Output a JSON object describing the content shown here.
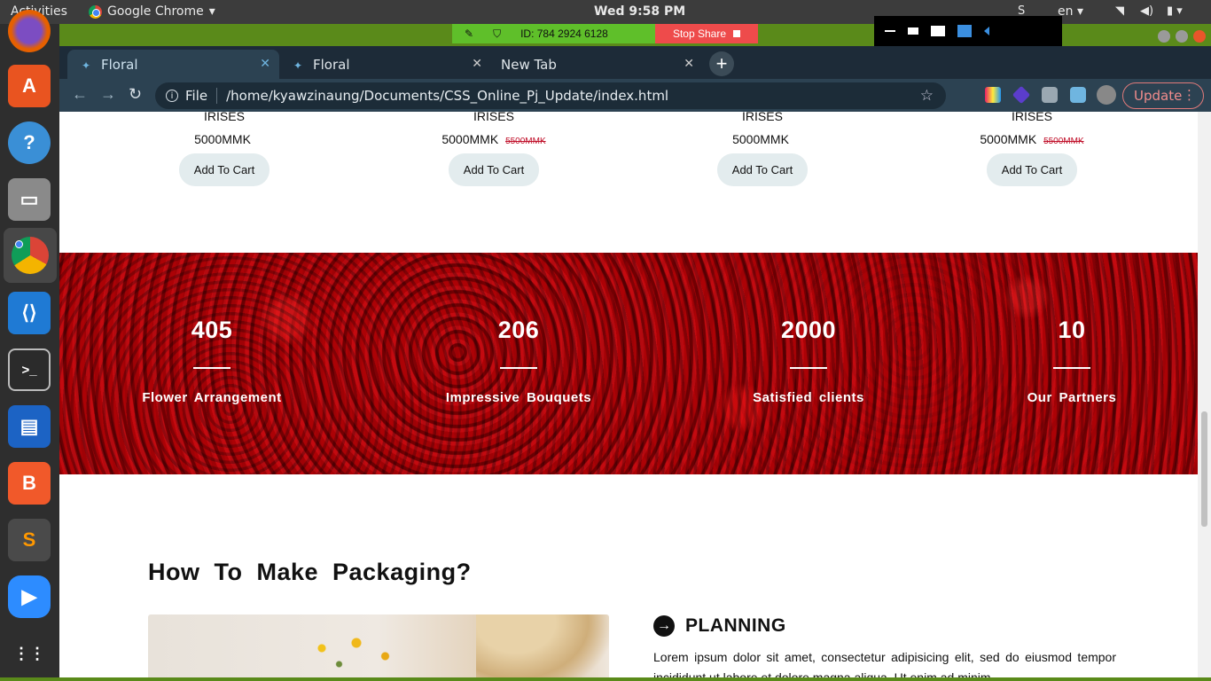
{
  "topbar": {
    "activities": "Activities",
    "app_name": "Google Chrome",
    "clock": "Wed  9:58 PM",
    "lang": "en"
  },
  "share": {
    "meeting_id": "ID: 784 2924 6128",
    "stop_label": "Stop Share"
  },
  "browser": {
    "tabs": [
      {
        "title": "Floral",
        "active": true
      },
      {
        "title": "Floral",
        "active": false
      },
      {
        "title": "New Tab",
        "active": false
      }
    ],
    "url_scheme": "File",
    "url": "/home/kyawzinaung/Documents/CSS_Online_Pj_Update/index.html",
    "update_label": "Update"
  },
  "products": [
    {
      "name": "IRISES",
      "price": "5000MMK",
      "old_price": "",
      "cart": "Add To Cart"
    },
    {
      "name": "IRISES",
      "price": "5000MMK",
      "old_price": "5500MMK",
      "cart": "Add To Cart"
    },
    {
      "name": "IRISES",
      "price": "5000MMK",
      "old_price": "",
      "cart": "Add To Cart"
    },
    {
      "name": "IRISES",
      "price": "5000MMK",
      "old_price": "5500MMK",
      "cart": "Add To Cart"
    }
  ],
  "stats": [
    {
      "value": "405",
      "label": "Flower Arrangement"
    },
    {
      "value": "206",
      "label": "Impressive Bouquets"
    },
    {
      "value": "2000",
      "label": "Satisfied clients"
    },
    {
      "value": "10",
      "label": "Our Partners"
    }
  ],
  "packaging": {
    "title": "How To Make Packaging?",
    "step_title": "PLANNING",
    "step_text": "Lorem ipsum dolor sit amet, consectetur adipisicing elit, sed do eiusmod tempor incididunt ut labore et dolore magna aliqua. Ut enim ad minim"
  },
  "colors": {
    "desktop_green": "#5a8a1a",
    "share_green": "#5fbf2a",
    "share_red": "#ee4b4b",
    "rose_red": "#a3000a",
    "old_price_red": "#c0102a"
  },
  "icons": [
    "chrome-icon",
    "shield-icon",
    "star-icon",
    "info-icon",
    "arrow-right-circle-icon",
    "video-icon",
    "wifi-icon",
    "volume-icon",
    "battery-icon"
  ]
}
